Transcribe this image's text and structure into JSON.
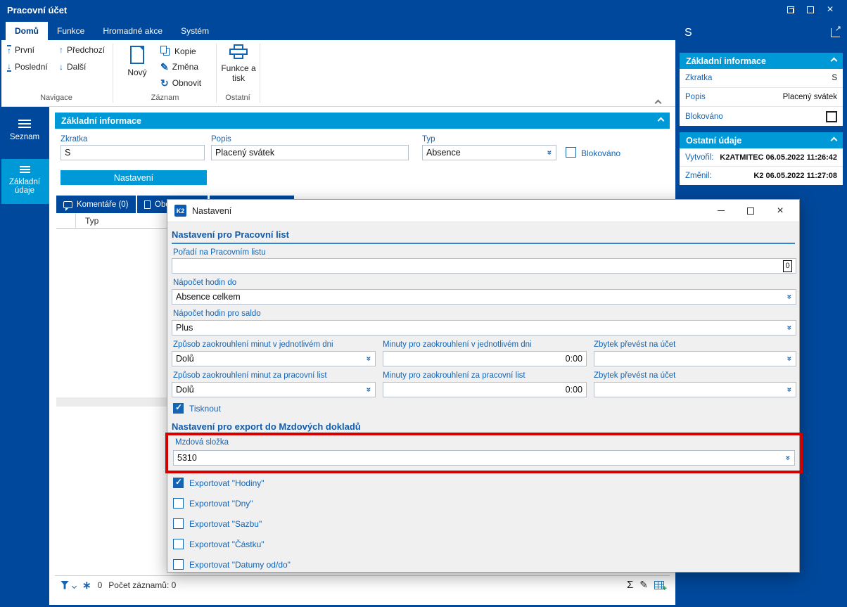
{
  "window": {
    "title": "Pracovní účet"
  },
  "icons": {
    "up": "↑",
    "down": "↓",
    "pencil": "✎",
    "refresh": "↻",
    "sigma": "Σ",
    "asterisk": "∗",
    "close": "×",
    "minus": "",
    "lookup": "»",
    "expand_arrow": "↗"
  },
  "ribbon": {
    "tabs": [
      {
        "label": "Domů",
        "active": true
      },
      {
        "label": "Funkce",
        "active": false
      },
      {
        "label": "Hromadné akce",
        "active": false
      },
      {
        "label": "Systém",
        "active": false
      }
    ],
    "nav_group": {
      "label": "Navigace",
      "first": "První",
      "last": "Poslední",
      "previous": "Předchozí",
      "next": "Další"
    },
    "record_group": {
      "label": "Záznam",
      "new": "Nový",
      "copy": "Kopie",
      "change": "Změna",
      "refresh": "Obnovit"
    },
    "other_group": {
      "label": "Ostatní",
      "print": "Funkce a tisk"
    }
  },
  "sidebar": {
    "seznam": "Seznam",
    "zakladni_udaje": "Základní údaje"
  },
  "main": {
    "section_title": "Základní informace",
    "zkratka_label": "Zkratka",
    "zkratka_value": "S",
    "popis_label": "Popis",
    "popis_value": "Placený svátek",
    "typ_label": "Typ",
    "typ_value": "Absence",
    "blokovano_label": "Blokováno",
    "nastaveni_button": "Nastavení",
    "tab_komentare": "Komentáře (0)",
    "tab_obc": "Obc",
    "table_col_typ": "Typ",
    "status_count": "0",
    "status_records": "Počet záznamů: 0"
  },
  "dialog": {
    "k2_logo_text": "K2",
    "title": "Nastavení",
    "heading_worklist": "Nastavení pro Pracovní list",
    "poradi_label": "Pořadí na Pracovním listu",
    "poradi_value": "0",
    "napocet_do_label": "Nápočet hodin do",
    "napocet_do_value": "Absence celkem",
    "napocet_saldo_label": "Nápočet hodin pro saldo",
    "napocet_saldo_value": "Plus",
    "zpusob_den_label": "Způsob zaokrouhlení minut v jednotlivém dni",
    "zpusob_den_value": "Dolů",
    "minuty_den_label": "Minuty pro zaokrouhlení v jednotlivém dni",
    "minuty_den_value": "0:00",
    "zbytek_den_label": "Zbytek převést na účet",
    "zbytek_den_value": "",
    "zpusob_list_label": "Způsob zaokrouhlení minut za pracovní list",
    "zpusob_list_value": "Dolů",
    "minuty_list_label": "Minuty pro zaokrouhlení za pracovní list",
    "minuty_list_value": "0:00",
    "zbytek_list_label": "Zbytek převést na účet",
    "zbytek_list_value": "",
    "tisknout_label": "Tisknout",
    "heading_export": "Nastavení pro export do Mzdových dokladů",
    "mzdova_slozka_label": "Mzdová složka",
    "mzdova_slozka_value": "5310",
    "export_hodiny": "Exportovat \"Hodiny\"",
    "export_dny": "Exportovat \"Dny\"",
    "export_sazbu": "Exportovat \"Sazbu\"",
    "export_castku": "Exportovat \"Částku\"",
    "export_datumy": "Exportovat \"Datumy od/do\""
  },
  "checks": {
    "blokovano_main": false,
    "blokovano_panel": false,
    "tisknout": true,
    "export_hodiny": true,
    "export_dny": false,
    "export_sazbu": false,
    "export_castku": false,
    "export_datumy": false
  },
  "right_panel": {
    "title": "S",
    "section1_title": "Základní informace",
    "zkratka_label": "Zkratka",
    "zkratka_value": "S",
    "popis_label": "Popis",
    "popis_value": "Placený svátek",
    "blokovano_label": "Blokováno",
    "section2_title": "Ostatní údaje",
    "vytvoril_label": "Vytvořil:",
    "vytvoril_value": "K2ATMITEC 06.05.2022 11:26:42",
    "zmenil_label": "Změnil:",
    "zmenil_value": "K2 06.05.2022 11:27:08"
  },
  "colors": {
    "navy": "#00489c",
    "cyan": "#0099d8",
    "label_blue": "#1464b4",
    "highlight_red": "#d40000"
  }
}
